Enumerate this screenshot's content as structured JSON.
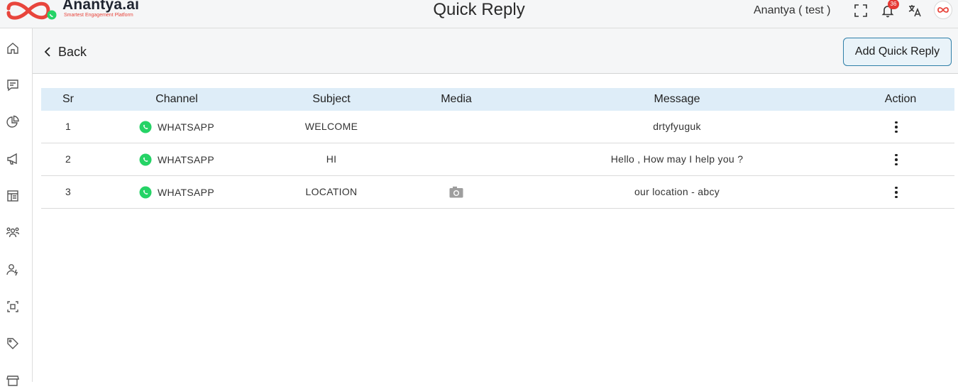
{
  "brand": {
    "name": "Anantya.ai",
    "tagline": "Smartest Engagement Platform"
  },
  "header": {
    "title": "Quick Reply",
    "user": "Anantya ( test )",
    "notification_count": "36"
  },
  "sidebar": {
    "items": [
      {
        "icon": "home-icon"
      },
      {
        "icon": "chat-icon"
      },
      {
        "icon": "analytics-icon"
      },
      {
        "icon": "megaphone-icon"
      },
      {
        "icon": "template-icon"
      },
      {
        "icon": "contacts-icon"
      },
      {
        "icon": "agent-icon"
      },
      {
        "icon": "integration-icon"
      },
      {
        "icon": "tag-icon"
      },
      {
        "icon": "store-icon"
      }
    ]
  },
  "toolbar": {
    "back_label": "Back",
    "add_label": "Add Quick Reply"
  },
  "table": {
    "columns": [
      "Sr",
      "Channel",
      "Subject",
      "Media",
      "Message",
      "Action"
    ],
    "rows": [
      {
        "sr": "1",
        "channel": "WHATSAPP",
        "subject": "WELCOME",
        "media": "",
        "message": "drtyfyuguk"
      },
      {
        "sr": "2",
        "channel": "WHATSAPP",
        "subject": "HI",
        "media": "",
        "message": "Hello , How may I help you ?"
      },
      {
        "sr": "3",
        "channel": "WHATSAPP",
        "subject": "LOCATION",
        "media": "camera-icon",
        "message": "our location - abcy"
      }
    ]
  },
  "colors": {
    "accent": "#2f7fa8",
    "header_bg": "#deedf8",
    "brand_red": "#e8453c",
    "whatsapp": "#25d366",
    "badge": "#e53935"
  }
}
